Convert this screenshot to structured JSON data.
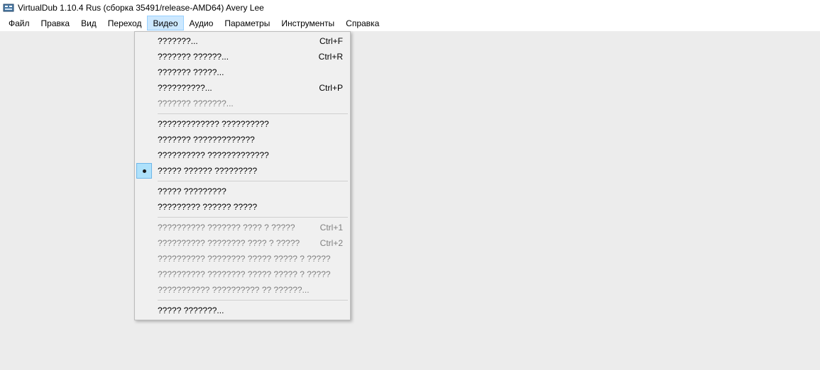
{
  "title": "VirtualDub 1.10.4 Rus (сборка 35491/release-AMD64) Avery Lee",
  "menus": {
    "file": "Файл",
    "edit": "Правка",
    "view": "Вид",
    "go": "Переход",
    "video": "Видео",
    "audio": "Аудио",
    "params": "Параметры",
    "tools": "Инструменты",
    "help": "Справка"
  },
  "video_menu": [
    {
      "label": "???????...",
      "shortcut": "Ctrl+F",
      "disabled": false
    },
    {
      "label": "??????? ??????...",
      "shortcut": "Ctrl+R",
      "disabled": false
    },
    {
      "label": "??????? ?????...",
      "shortcut": "",
      "disabled": false
    },
    {
      "label": "??????????...",
      "shortcut": "Ctrl+P",
      "disabled": false
    },
    {
      "label": "??????? ???????...",
      "shortcut": "",
      "disabled": true
    },
    {
      "sep": true
    },
    {
      "label": "????????????? ??????????",
      "shortcut": "",
      "disabled": false
    },
    {
      "label": "??????? ?????????????",
      "shortcut": "",
      "disabled": false
    },
    {
      "label": "?????????? ?????????????",
      "shortcut": "",
      "disabled": false
    },
    {
      "label": "????? ?????? ?????????",
      "shortcut": "",
      "disabled": false,
      "bullet": true
    },
    {
      "sep": true
    },
    {
      "label": "????? ?????????",
      "shortcut": "",
      "disabled": false
    },
    {
      "label": "????????? ?????? ?????",
      "shortcut": "",
      "disabled": false
    },
    {
      "sep": true
    },
    {
      "label": "?????????? ??????? ???? ? ?????",
      "shortcut": "Ctrl+1",
      "disabled": true
    },
    {
      "label": "?????????? ???????? ???? ? ?????",
      "shortcut": "Ctrl+2",
      "disabled": true
    },
    {
      "label": "?????????? ???????? ????? ????? ? ?????",
      "shortcut": "",
      "disabled": true
    },
    {
      "label": "?????????? ???????? ????? ????? ? ?????",
      "shortcut": "",
      "disabled": true
    },
    {
      "label": "??????????? ?????????? ?? ??????...",
      "shortcut": "",
      "disabled": true
    },
    {
      "sep": true
    },
    {
      "label": "????? ???????...",
      "shortcut": "",
      "disabled": false
    }
  ]
}
